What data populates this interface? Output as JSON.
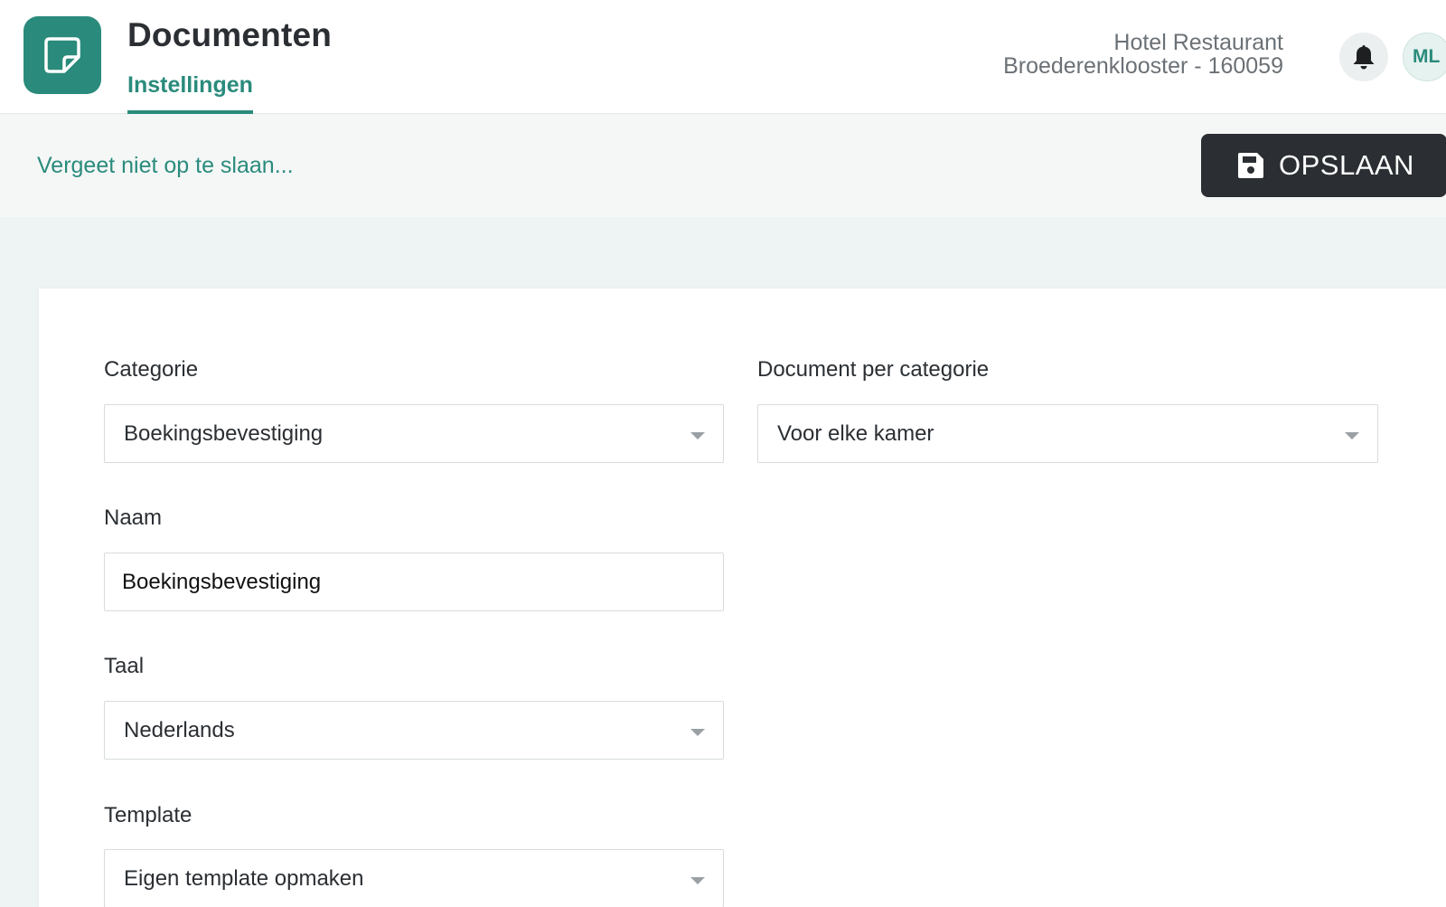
{
  "header": {
    "title": "Documenten",
    "active_tab": "Instellingen",
    "hotel_line1": "Hotel Restaurant",
    "hotel_line2": "Broederenklooster - 160059",
    "avatar_initials": "ML",
    "logo_icon": "document-icon",
    "bell_icon": "bell-icon"
  },
  "save_bar": {
    "reminder": "Vergeet niet op te slaan...",
    "save_label": "OPSLAAN",
    "save_icon": "floppy-disk-icon"
  },
  "form": {
    "categorie": {
      "label": "Categorie",
      "value": "Boekingsbevestiging"
    },
    "document_per_categorie": {
      "label": "Document per categorie",
      "value": "Voor elke kamer"
    },
    "naam": {
      "label": "Naam",
      "value": "Boekingsbevestiging"
    },
    "taal": {
      "label": "Taal",
      "value": "Nederlands"
    },
    "template": {
      "label": "Template",
      "value": "Eigen template opmaken"
    }
  },
  "colors": {
    "accent": "#2a8b7c",
    "dark": "#2b2f33",
    "background": "#eef4f3"
  }
}
